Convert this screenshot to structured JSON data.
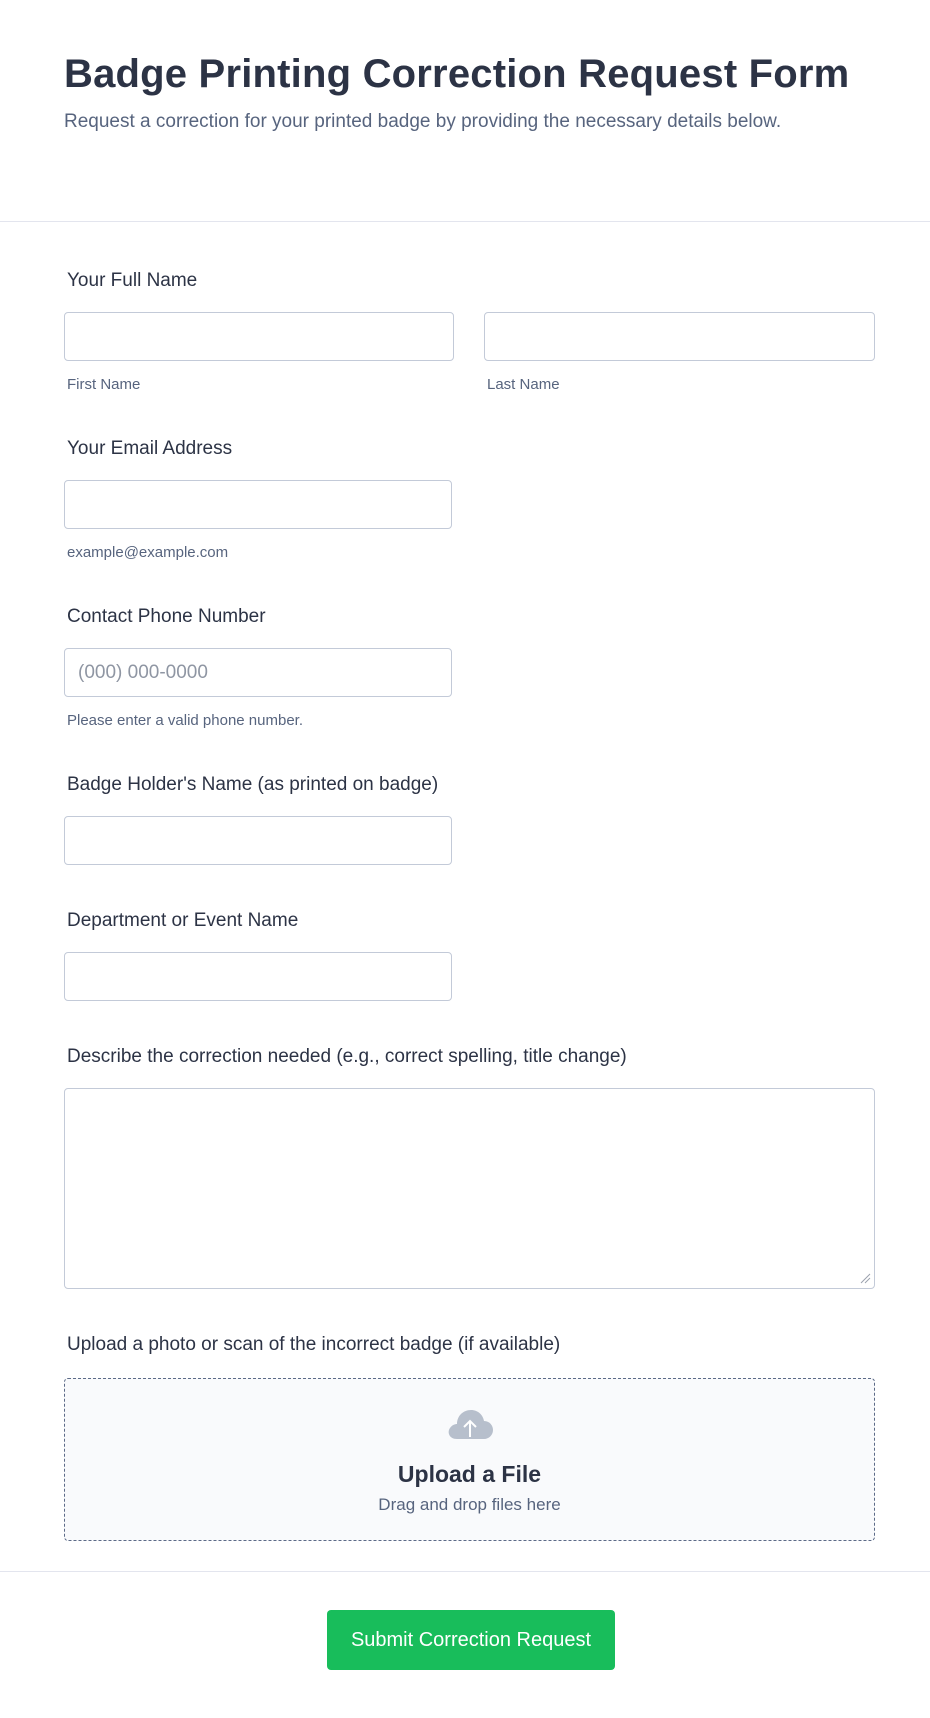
{
  "form": {
    "title": "Badge Printing Correction Request Form",
    "subtitle": "Request a correction for your printed badge by providing the necessary details below."
  },
  "fields": {
    "full_name": {
      "label": "Your Full Name",
      "first_sublabel": "First Name",
      "last_sublabel": "Last Name",
      "first_value": "",
      "last_value": ""
    },
    "email": {
      "label": "Your Email Address",
      "sublabel": "example@example.com",
      "value": ""
    },
    "phone": {
      "label": "Contact Phone Number",
      "placeholder": "(000) 000-0000",
      "sublabel": "Please enter a valid phone number.",
      "value": ""
    },
    "badge_holder": {
      "label": "Badge Holder's Name (as printed on badge)",
      "value": ""
    },
    "department": {
      "label": "Department or Event Name",
      "value": ""
    },
    "correction": {
      "label": "Describe the correction needed (e.g., correct spelling, title change)",
      "value": ""
    },
    "upload": {
      "label": "Upload a photo or scan of the incorrect badge (if available)",
      "icon": "cloud-upload-icon",
      "title": "Upload a File",
      "subtitle": "Drag and drop files here"
    }
  },
  "submit": {
    "label": "Submit Correction Request",
    "color": "#18bd5b"
  }
}
